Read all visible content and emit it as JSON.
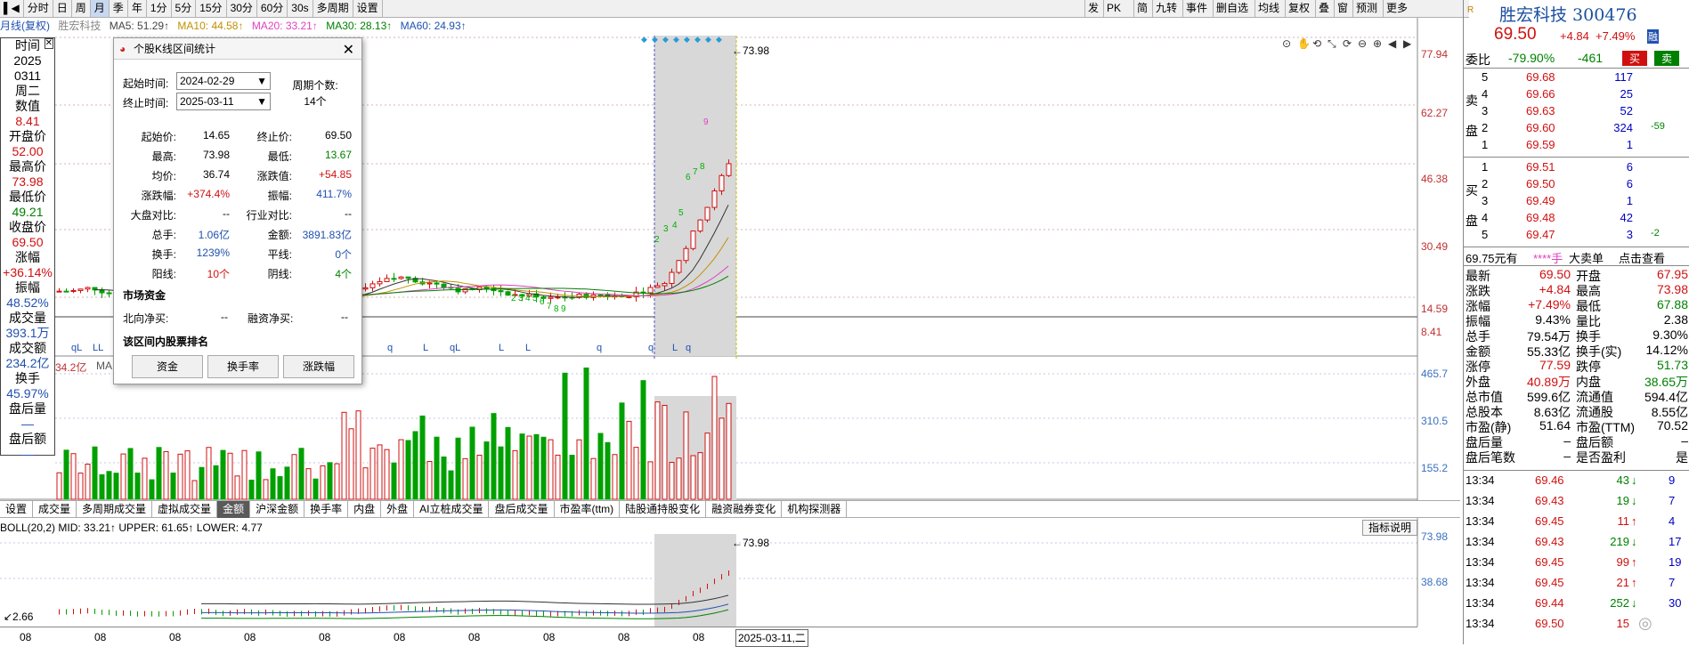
{
  "toolbar": {
    "items": [
      "分时",
      "日",
      "周",
      "月",
      "季",
      "年",
      "1分",
      "5分",
      "15分",
      "30分",
      "60分",
      "30s",
      "多周期",
      "设置"
    ],
    "selected_index": 3,
    "right_items": [
      "发",
      "PK",
      "简",
      "九转",
      "事件",
      "删自选",
      "均线",
      "复权",
      "叠",
      "窗",
      "预测",
      "更多"
    ]
  },
  "ma_bar": {
    "label": "月线(复权)",
    "stock": "胜宏科技",
    "ma5": "MA5: 51.29↑",
    "ma10": "MA10: 44.58↑",
    "ma20": "MA20: 33.21↑",
    "ma30": "MA30: 28.13↑",
    "ma60": "MA60: 24.93↑"
  },
  "price_axis": [
    "77.94",
    "62.27",
    "46.38",
    "30.49",
    "14.59",
    "8.41"
  ],
  "vol_axis": [
    "465.7",
    "310.5",
    "155.2"
  ],
  "boll_axis": [
    "73.98",
    "38.68"
  ],
  "high_marker": "73.98",
  "boll_high_marker": "73.98",
  "boll_low_marker": "2.66",
  "vol_left_label": "34.2亿",
  "vol_ma_label": "MA",
  "left_panel": [
    {
      "l": "时间",
      "v": "2025"
    },
    {
      "l": "0311",
      "v": "周二"
    },
    {
      "l": "数值",
      "v": "8.41"
    },
    {
      "l": "开盘价",
      "v": "52.00"
    },
    {
      "l": "最高价",
      "v": "73.98"
    },
    {
      "l": "最低价",
      "v": "49.21"
    },
    {
      "l": "收盘价",
      "v": "69.50"
    },
    {
      "l": "涨幅",
      "v": "+36.14%"
    },
    {
      "l": "振幅",
      "v": "48.52%"
    },
    {
      "l": "成交量",
      "v": "393.1万"
    },
    {
      "l": "成交额",
      "v": "234.2亿"
    },
    {
      "l": "换手",
      "v": "45.97%"
    },
    {
      "l": "盘后量",
      "v": "—"
    },
    {
      "l": "盘后额",
      "v": "—"
    }
  ],
  "dialog": {
    "title": "个股K线区间统计",
    "start_label": "起始时间:",
    "start_value": "2024-02-29",
    "end_label": "终止时间:",
    "end_value": "2025-03-11",
    "period_label": "周期个数:",
    "period_value": "14个",
    "stats": [
      [
        "起始价:",
        "14.65",
        "终止价:",
        "69.50"
      ],
      [
        "最高:",
        "73.98",
        "最低:",
        "13.67"
      ],
      [
        "均价:",
        "36.74",
        "涨跌值:",
        "+54.85"
      ],
      [
        "涨跌幅:",
        "+374.4%",
        "振幅:",
        "411.7%"
      ],
      [
        "大盘对比:",
        "--",
        "行业对比:",
        "--"
      ],
      [
        "总手:",
        "1.06亿",
        "金额:",
        "3891.83亿"
      ],
      [
        "换手:",
        "1239%",
        "平线:",
        "0个"
      ],
      [
        "阳线:",
        "10个",
        "阴线:",
        "4个"
      ]
    ],
    "capital_title": "市场资金",
    "north_label": "北向净买:",
    "north_value": "--",
    "margin_label": "融资净买:",
    "margin_value": "--",
    "rank_title": "该区间内股票排名",
    "buttons": [
      "资金",
      "换手率",
      "涨跌幅"
    ]
  },
  "tabs": [
    "设置",
    "成交量",
    "多周期成交量",
    "虚拟成交量",
    "金额",
    "沪深金额",
    "换手率",
    "内盘",
    "外盘",
    "AI立桩成交量",
    "盘后成交量",
    "市盈率(ttm)",
    "陆股通持股变化",
    "融资融券变化",
    "机构探测器"
  ],
  "tabs_selected": 4,
  "boll": {
    "label": "BOLL(20,2) MID: 33.21↑ UPPER: 61.65↑ LOWER: 4.77",
    "button": "指标说明"
  },
  "date_axis": [
    "08",
    "08",
    "08",
    "08",
    "08",
    "08",
    "08",
    "08",
    "08",
    "08",
    "08"
  ],
  "date_current": "2025-03-11,二",
  "quote": {
    "name": "胜宏科技",
    "code": "300476",
    "price": "69.50",
    "chg": "+4.84",
    "pct": "+7.49%",
    "tag": "融",
    "buy_btn": "买",
    "sell_btn": "卖",
    "weibi_label": "委比",
    "weibi": "-79.90%",
    "weicha": "-461",
    "sell": [
      [
        "5",
        "69.68",
        "117",
        ""
      ],
      [
        "4",
        "69.66",
        "25",
        ""
      ],
      [
        "3",
        "69.63",
        "52",
        ""
      ],
      [
        "2",
        "69.60",
        "324",
        "-59"
      ],
      [
        "1",
        "69.59",
        "1",
        ""
      ]
    ],
    "buy": [
      [
        "1",
        "69.51",
        "6",
        ""
      ],
      [
        "2",
        "69.50",
        "6",
        ""
      ],
      [
        "3",
        "69.49",
        "1",
        ""
      ],
      [
        "4",
        "69.48",
        "42",
        ""
      ],
      [
        "5",
        "69.47",
        "3",
        "-2"
      ]
    ],
    "side_sell": [
      "卖",
      "盘"
    ],
    "side_buy": [
      "买",
      "盘"
    ],
    "ad": [
      "69.75元有",
      "****手",
      "大卖单",
      "点击查看"
    ],
    "stats": [
      [
        "最新",
        "69.50",
        "开盘",
        "67.95"
      ],
      [
        "涨跌",
        "+4.84",
        "最高",
        "73.98"
      ],
      [
        "涨幅",
        "+7.49%",
        "最低",
        "67.88"
      ],
      [
        "振幅",
        "9.43%",
        "量比",
        "2.38"
      ],
      [
        "总手",
        "79.54万",
        "换手",
        "9.30%"
      ],
      [
        "金额",
        "55.33亿",
        "换手(实)",
        "14.12%"
      ],
      [
        "涨停",
        "77.59",
        "跌停",
        "51.73"
      ],
      [
        "外盘",
        "40.89万",
        "内盘",
        "38.65万"
      ],
      [
        "总市值",
        "599.6亿",
        "流通值",
        "594.4亿"
      ],
      [
        "总股本",
        "8.63亿",
        "流通股",
        "8.55亿"
      ],
      [
        "市盈(静)",
        "51.64",
        "市盈(TTM)",
        "70.52"
      ],
      [
        "盘后量",
        "–",
        "盘后额",
        "–"
      ],
      [
        "盘后笔数",
        "–",
        "是否盈利",
        "是"
      ]
    ],
    "ticks": [
      [
        "13:34",
        "69.46",
        "43",
        "↓",
        "9"
      ],
      [
        "13:34",
        "69.43",
        "19",
        "↓",
        "7"
      ],
      [
        "13:34",
        "69.45",
        "11",
        "↑",
        "4"
      ],
      [
        "13:34",
        "69.43",
        "219",
        "↓",
        "17"
      ],
      [
        "13:34",
        "69.45",
        "99",
        "↑",
        "19"
      ],
      [
        "13:34",
        "69.45",
        "21",
        "↑",
        "7"
      ],
      [
        "13:34",
        "69.44",
        "252",
        "↓",
        "30"
      ],
      [
        "13:34",
        "69.50",
        "15",
        "",
        ""
      ]
    ]
  },
  "colors": {
    "up": "#d01010",
    "down": "#00a000",
    "accent": "#2050b0",
    "selection": "#d8d8d8"
  }
}
